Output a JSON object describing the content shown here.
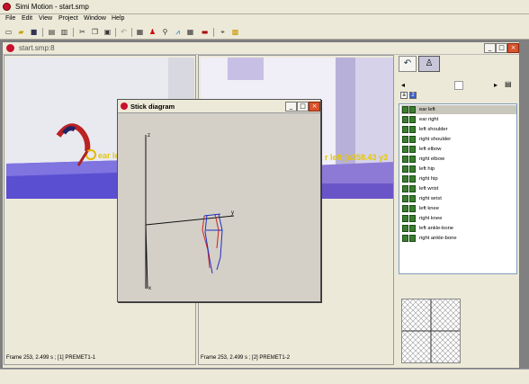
{
  "app": {
    "title": "Simi Motion - start.smp",
    "menu": [
      "File",
      "Edit",
      "View",
      "Project",
      "Window",
      "Help"
    ]
  },
  "toolbar": {
    "icons": [
      "new-file-icon",
      "open-folder-icon",
      "save-icon",
      "print-preview-icon",
      "print-icon",
      "cut-icon",
      "copy-icon",
      "paste-icon",
      "undo-icon",
      "project-icon",
      "person-icon",
      "stick-figure-icon",
      "chart-icon",
      "table-icon",
      "video-icon",
      "cursor-icon",
      "settings-icon"
    ]
  },
  "document": {
    "title": "start.smp:8"
  },
  "video_left": {
    "label": "ear le",
    "status": "Frame 253, 2.499 s ; [1] PREMET1-1"
  },
  "video_right": {
    "label": "r left [x358.43 y3",
    "status": "Frame 253, 2.499 s ; [2] PREMET1-2"
  },
  "stick": {
    "title": "Stick diagram",
    "axis_z": "z",
    "axis_x": "x",
    "axis_y": "y"
  },
  "points_panel": {
    "header_a": "a",
    "header_b": "2",
    "items": [
      "ear left",
      "ear right",
      "left shoulder",
      "right shoulder",
      "left elbow",
      "right elbow",
      "left hip",
      "right hip",
      "left wrist",
      "right wrist",
      "left knee",
      "right knee",
      "left ankle-bone",
      "right ankle-bone"
    ],
    "selected_index": 0
  },
  "colors": {
    "video_floor_left": "#5a4fd0",
    "video_floor_right": "#6a55c8",
    "stick_red": "#d02020",
    "stick_blue": "#2030c0"
  }
}
